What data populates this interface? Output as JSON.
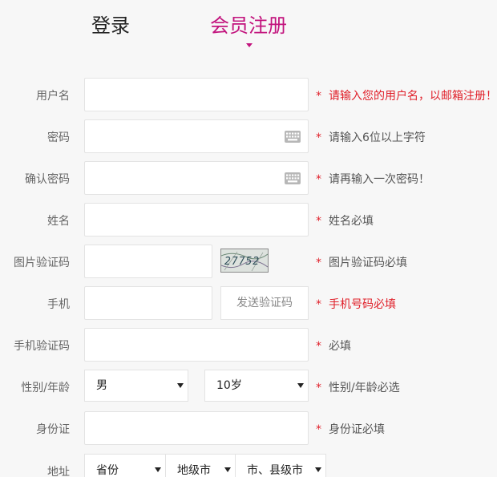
{
  "tabs": {
    "login": "登录",
    "register": "会员注册"
  },
  "form": {
    "username": {
      "label": "用户名",
      "value": "",
      "hint": "请输入您的用户名，以邮箱注册！"
    },
    "password": {
      "label": "密码",
      "value": "",
      "hint": "请输入6位以上字符"
    },
    "confirm_password": {
      "label": "确认密码",
      "value": "",
      "hint": "请再输入一次密码！"
    },
    "name": {
      "label": "姓名",
      "value": "",
      "hint": "姓名必填"
    },
    "image_captcha": {
      "label": "图片验证码",
      "value": "",
      "captcha_text": "27752",
      "hint": "图片验证码必填"
    },
    "phone": {
      "label": "手机",
      "value": "",
      "send_code_label": "发送验证码",
      "hint": "手机号码必填"
    },
    "phone_code": {
      "label": "手机验证码",
      "value": "",
      "hint": "必填"
    },
    "gender_age": {
      "label": "性别/年龄",
      "gender": "男",
      "age": "10岁",
      "hint": "性别/年龄必选"
    },
    "id_card": {
      "label": "身份证",
      "value": "",
      "hint": "身份证必填"
    },
    "address": {
      "label": "地址",
      "province": "省份",
      "city": "地级市",
      "county": "市、县级市"
    }
  },
  "required_mark": "*",
  "colors": {
    "accent": "#c2137d",
    "required": "#e0202a",
    "background": "#f7f7f7"
  },
  "icons": {
    "password_keyboard": "keyboard-icon",
    "confirm_keyboard": "keyboard-icon"
  }
}
